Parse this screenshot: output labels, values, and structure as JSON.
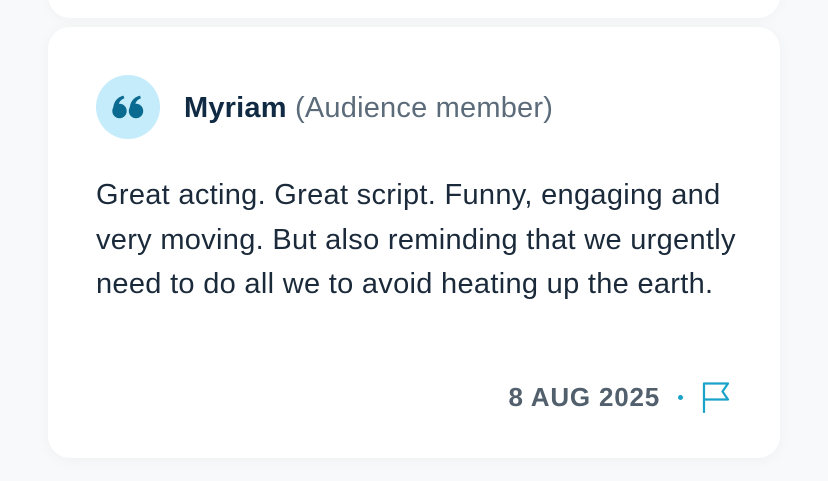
{
  "review": {
    "author_name": "Myriam",
    "author_role": "(Audience member)",
    "text": "Great acting. Great script. Funny, engaging and very moving. But also reminding that we urgently need to do all we to avoid heating up the earth.",
    "date": "8 AUG 2025",
    "avatar_icon": "quote-icon",
    "flag_icon": "flag-icon"
  },
  "colors": {
    "avatar_bg": "#c4ecfb",
    "quote_mark": "#0b6a8f",
    "accent": "#1aa3c8",
    "name": "#102a43",
    "role": "#5c6b7a",
    "date": "#52606d"
  }
}
